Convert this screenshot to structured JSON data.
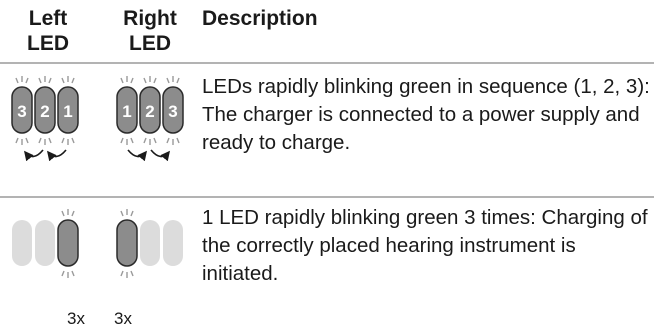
{
  "table": {
    "headers": {
      "left": [
        "Left",
        "LED"
      ],
      "right": [
        "Right",
        "LED"
      ],
      "description": "Description"
    },
    "rows": [
      {
        "left_led_numbers": [
          "3",
          "2",
          "1"
        ],
        "right_led_numbers": [
          "1",
          "2",
          "3"
        ],
        "description": [
          "LEDs rapidly blinking green in sequence (1, 2, 3):",
          "The charger is connected to a power supply and ready to charge."
        ]
      },
      {
        "left_led_count": "3x",
        "right_led_count": "3x",
        "description": [
          "1 LED rapidly blinking green 3 times: Charging of the correctly placed hearing instrument is initiated."
        ]
      }
    ]
  },
  "colors": {
    "led_active_dark": "#8c8c8c",
    "led_inactive": "#dcdcdc",
    "rule": "#b3b3b3"
  }
}
